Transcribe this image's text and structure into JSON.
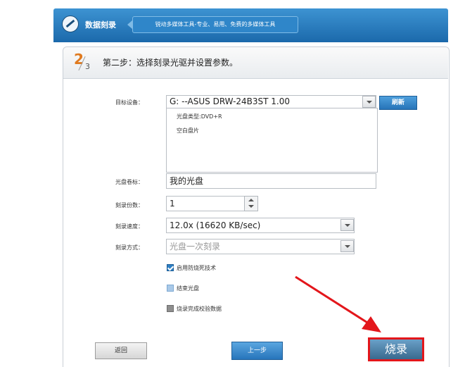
{
  "header": {
    "app_title": "数据刻录",
    "slogan": "锐动多媒体工具-专业、易用、免费的多媒体工具"
  },
  "step": {
    "current": "2",
    "total": "3",
    "title": "第二步：选择刻录光驱并设置参数。"
  },
  "form": {
    "device_label": "目标设备：",
    "device_value": "G:  --ASUS    DRW-24B3ST       1.00",
    "refresh_label": "刷新",
    "disc_type": "光盘类型:DVD+R",
    "disc_status": "空白盘片",
    "volume_label": "光盘卷标：",
    "volume_value": "我的光盘",
    "copies_label": "刻录份数：",
    "copies_value": "1",
    "speed_label": "刻录速度：",
    "speed_value": "12.0x (16620 KB/sec)",
    "mode_label": "刻录方式：",
    "mode_value": "光盘一次刻录"
  },
  "options": [
    {
      "label": "启用防烧死技术",
      "checked": true
    },
    {
      "label": "结束光盘",
      "checked": false
    },
    {
      "label": "烧录完成校验数据",
      "checked": false
    }
  ],
  "buttons": {
    "back": "返回",
    "prev": "上一步",
    "burn": "烧录"
  },
  "colors": {
    "header_blue": "#1b69ab",
    "step_orange": "#e07a1f",
    "highlight_red": "#e3161b"
  }
}
